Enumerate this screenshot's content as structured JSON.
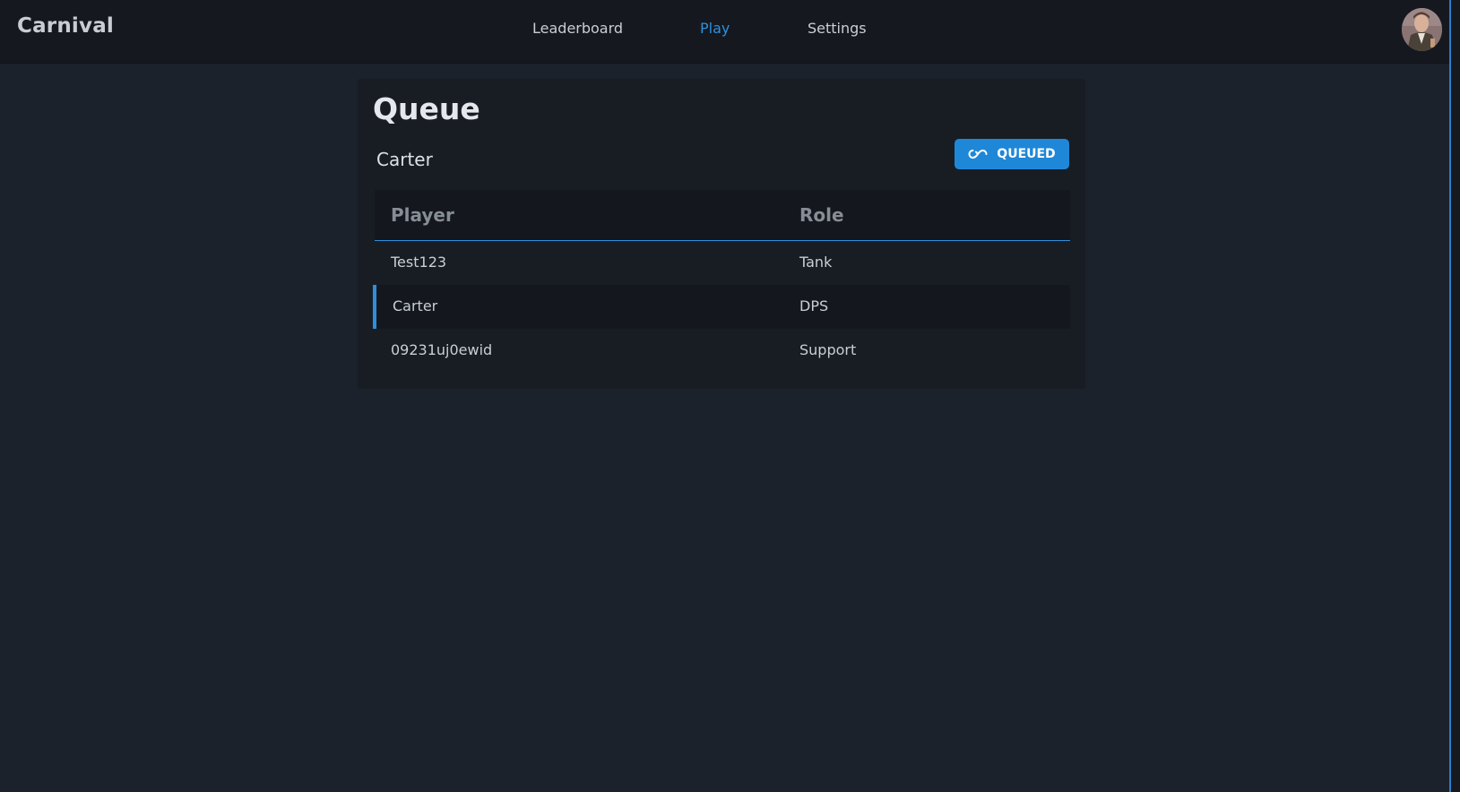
{
  "navbar": {
    "brand": "Carnival",
    "links": [
      {
        "label": "Leaderboard",
        "active": false
      },
      {
        "label": "Play",
        "active": true
      },
      {
        "label": "Settings",
        "active": false
      }
    ]
  },
  "colors": {
    "accent": "#2e8fdc",
    "background": "#1c222b",
    "navbar": "#15191f",
    "card": "#181d24",
    "button": "#1f87d8"
  },
  "queue": {
    "title": "Queue",
    "username": "Carter",
    "status_button": {
      "label": "QUEUED",
      "icon": "infinity-icon"
    },
    "table": {
      "headers": [
        "Player",
        "Role"
      ],
      "rows": [
        {
          "player": "Test123",
          "role": "Tank",
          "current_user": false
        },
        {
          "player": "Carter",
          "role": "DPS",
          "current_user": true
        },
        {
          "player": "09231uj0ewid",
          "role": "Support",
          "current_user": false
        }
      ]
    }
  }
}
